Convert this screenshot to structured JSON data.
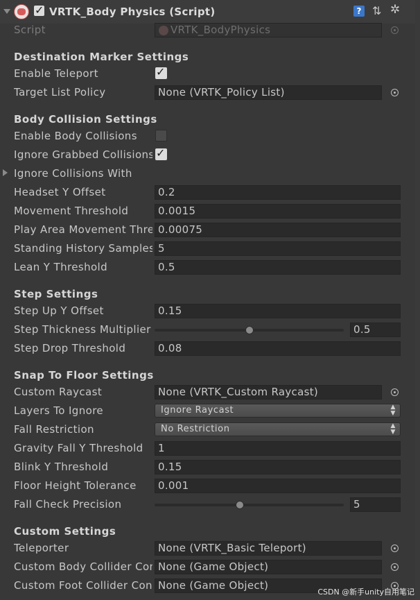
{
  "header": {
    "title": "VRTK_Body Physics (Script)",
    "enabled": true,
    "icons": [
      "component-icon",
      "help-icon",
      "preset-icon",
      "gear-icon"
    ]
  },
  "script_row": {
    "label": "Script",
    "value": "VRTK_BodyPhysics"
  },
  "destination": {
    "title": "Destination Marker Settings",
    "enable_teleport_label": "Enable Teleport",
    "enable_teleport": true,
    "target_list_label": "Target List Policy",
    "target_list_value": "None (VRTK_Policy List)"
  },
  "body_collision": {
    "title": "Body Collision Settings",
    "enable_body_label": "Enable Body Collisions",
    "enable_body": false,
    "ignore_grabbed_label": "Ignore Grabbed Collisions",
    "ignore_grabbed": true,
    "ignore_with_label": "Ignore Collisions With",
    "headset_label": "Headset Y Offset",
    "headset_value": "0.2",
    "movement_label": "Movement Threshold",
    "movement_value": "0.0015",
    "play_area_label": "Play Area Movement Threshold",
    "play_area_value": "0.00075",
    "standing_label": "Standing History Samples",
    "standing_value": "5",
    "lean_label": "Lean Y Threshold",
    "lean_value": "0.5"
  },
  "step": {
    "title": "Step Settings",
    "step_up_label": "Step Up Y Offset",
    "step_up_value": "0.15",
    "thickness_label": "Step Thickness Multiplier",
    "thickness_value": "0.5",
    "thickness_fraction": 0.5,
    "drop_label": "Step Drop Threshold",
    "drop_value": "0.08"
  },
  "snap": {
    "title": "Snap To Floor Settings",
    "raycast_label": "Custom Raycast",
    "raycast_value": "None (VRTK_Custom Raycast)",
    "layers_label": "Layers To Ignore",
    "layers_value": "Ignore Raycast",
    "fall_label": "Fall Restriction",
    "fall_value": "No Restriction",
    "gravity_label": "Gravity Fall Y Threshold",
    "gravity_value": "1",
    "blink_label": "Blink Y Threshold",
    "blink_value": "0.15",
    "floor_label": "Floor Height Tolerance",
    "floor_value": "0.001",
    "precision_label": "Fall Check Precision",
    "precision_value": "5",
    "precision_fraction": 0.45
  },
  "custom": {
    "title": "Custom Settings",
    "teleporter_label": "Teleporter",
    "teleporter_value": "None (VRTK_Basic Teleport)",
    "body_collider_label": "Custom Body Collider Container",
    "body_collider_value": "None (Game Object)",
    "foot_collider_label": "Custom Foot Collider Container",
    "foot_collider_value": "None (Game Object)"
  },
  "watermark": "CSDN @新手unity自用笔记"
}
